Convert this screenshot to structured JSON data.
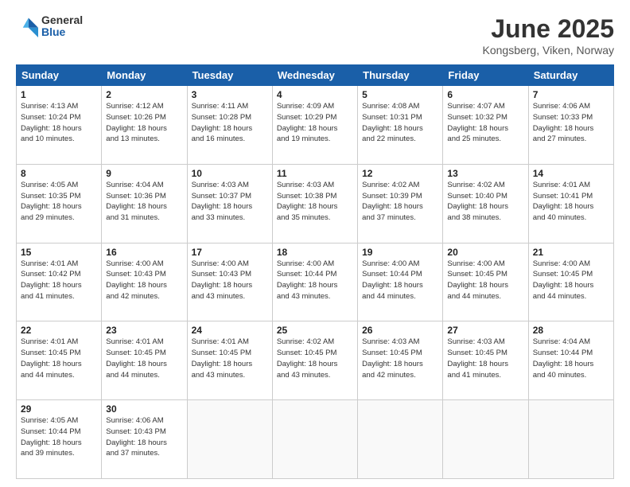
{
  "header": {
    "logo_general": "General",
    "logo_blue": "Blue",
    "title": "June 2025",
    "location": "Kongsberg, Viken, Norway"
  },
  "weekdays": [
    "Sunday",
    "Monday",
    "Tuesday",
    "Wednesday",
    "Thursday",
    "Friday",
    "Saturday"
  ],
  "weeks": [
    [
      {
        "day": "1",
        "info": "Sunrise: 4:13 AM\nSunset: 10:24 PM\nDaylight: 18 hours\nand 10 minutes."
      },
      {
        "day": "2",
        "info": "Sunrise: 4:12 AM\nSunset: 10:26 PM\nDaylight: 18 hours\nand 13 minutes."
      },
      {
        "day": "3",
        "info": "Sunrise: 4:11 AM\nSunset: 10:28 PM\nDaylight: 18 hours\nand 16 minutes."
      },
      {
        "day": "4",
        "info": "Sunrise: 4:09 AM\nSunset: 10:29 PM\nDaylight: 18 hours\nand 19 minutes."
      },
      {
        "day": "5",
        "info": "Sunrise: 4:08 AM\nSunset: 10:31 PM\nDaylight: 18 hours\nand 22 minutes."
      },
      {
        "day": "6",
        "info": "Sunrise: 4:07 AM\nSunset: 10:32 PM\nDaylight: 18 hours\nand 25 minutes."
      },
      {
        "day": "7",
        "info": "Sunrise: 4:06 AM\nSunset: 10:33 PM\nDaylight: 18 hours\nand 27 minutes."
      }
    ],
    [
      {
        "day": "8",
        "info": "Sunrise: 4:05 AM\nSunset: 10:35 PM\nDaylight: 18 hours\nand 29 minutes."
      },
      {
        "day": "9",
        "info": "Sunrise: 4:04 AM\nSunset: 10:36 PM\nDaylight: 18 hours\nand 31 minutes."
      },
      {
        "day": "10",
        "info": "Sunrise: 4:03 AM\nSunset: 10:37 PM\nDaylight: 18 hours\nand 33 minutes."
      },
      {
        "day": "11",
        "info": "Sunrise: 4:03 AM\nSunset: 10:38 PM\nDaylight: 18 hours\nand 35 minutes."
      },
      {
        "day": "12",
        "info": "Sunrise: 4:02 AM\nSunset: 10:39 PM\nDaylight: 18 hours\nand 37 minutes."
      },
      {
        "day": "13",
        "info": "Sunrise: 4:02 AM\nSunset: 10:40 PM\nDaylight: 18 hours\nand 38 minutes."
      },
      {
        "day": "14",
        "info": "Sunrise: 4:01 AM\nSunset: 10:41 PM\nDaylight: 18 hours\nand 40 minutes."
      }
    ],
    [
      {
        "day": "15",
        "info": "Sunrise: 4:01 AM\nSunset: 10:42 PM\nDaylight: 18 hours\nand 41 minutes."
      },
      {
        "day": "16",
        "info": "Sunrise: 4:00 AM\nSunset: 10:43 PM\nDaylight: 18 hours\nand 42 minutes."
      },
      {
        "day": "17",
        "info": "Sunrise: 4:00 AM\nSunset: 10:43 PM\nDaylight: 18 hours\nand 43 minutes."
      },
      {
        "day": "18",
        "info": "Sunrise: 4:00 AM\nSunset: 10:44 PM\nDaylight: 18 hours\nand 43 minutes."
      },
      {
        "day": "19",
        "info": "Sunrise: 4:00 AM\nSunset: 10:44 PM\nDaylight: 18 hours\nand 44 minutes."
      },
      {
        "day": "20",
        "info": "Sunrise: 4:00 AM\nSunset: 10:45 PM\nDaylight: 18 hours\nand 44 minutes."
      },
      {
        "day": "21",
        "info": "Sunrise: 4:00 AM\nSunset: 10:45 PM\nDaylight: 18 hours\nand 44 minutes."
      }
    ],
    [
      {
        "day": "22",
        "info": "Sunrise: 4:01 AM\nSunset: 10:45 PM\nDaylight: 18 hours\nand 44 minutes."
      },
      {
        "day": "23",
        "info": "Sunrise: 4:01 AM\nSunset: 10:45 PM\nDaylight: 18 hours\nand 44 minutes."
      },
      {
        "day": "24",
        "info": "Sunrise: 4:01 AM\nSunset: 10:45 PM\nDaylight: 18 hours\nand 43 minutes."
      },
      {
        "day": "25",
        "info": "Sunrise: 4:02 AM\nSunset: 10:45 PM\nDaylight: 18 hours\nand 43 minutes."
      },
      {
        "day": "26",
        "info": "Sunrise: 4:03 AM\nSunset: 10:45 PM\nDaylight: 18 hours\nand 42 minutes."
      },
      {
        "day": "27",
        "info": "Sunrise: 4:03 AM\nSunset: 10:45 PM\nDaylight: 18 hours\nand 41 minutes."
      },
      {
        "day": "28",
        "info": "Sunrise: 4:04 AM\nSunset: 10:44 PM\nDaylight: 18 hours\nand 40 minutes."
      }
    ],
    [
      {
        "day": "29",
        "info": "Sunrise: 4:05 AM\nSunset: 10:44 PM\nDaylight: 18 hours\nand 39 minutes."
      },
      {
        "day": "30",
        "info": "Sunrise: 4:06 AM\nSunset: 10:43 PM\nDaylight: 18 hours\nand 37 minutes."
      },
      {
        "day": "",
        "info": ""
      },
      {
        "day": "",
        "info": ""
      },
      {
        "day": "",
        "info": ""
      },
      {
        "day": "",
        "info": ""
      },
      {
        "day": "",
        "info": ""
      }
    ]
  ]
}
